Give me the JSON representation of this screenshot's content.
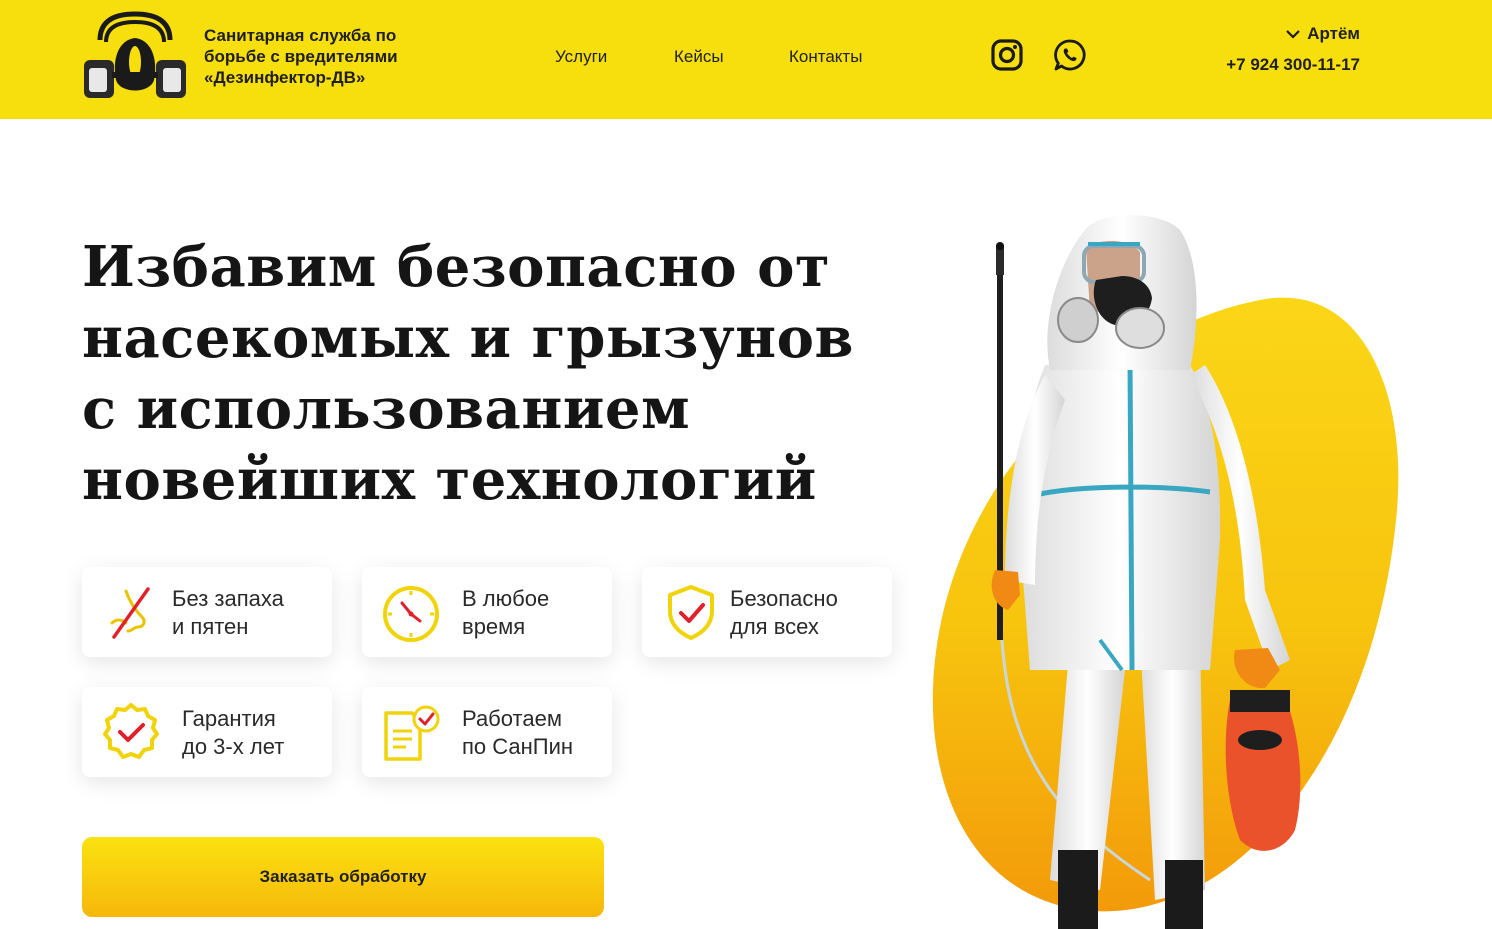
{
  "header": {
    "company_line1": "Санитарная служба по",
    "company_line2": "борьбе с вредителями",
    "company_line3": "«Дезинфектор-ДВ»",
    "nav": [
      "Услуги",
      "Кейсы",
      "Контакты"
    ],
    "social": [
      "instagram-icon",
      "whatsapp-icon"
    ],
    "contact_name": "Артём",
    "contact_phone": "+7 924 300-11-17"
  },
  "hero": {
    "title_lines": [
      "Избавим безопасно от",
      "насекомых и грызунов",
      "с использованием",
      "новейших технологий"
    ],
    "features": [
      {
        "icon": "no-smell-icon",
        "line1": "Без запаха",
        "line2": "и пятен"
      },
      {
        "icon": "clock-icon",
        "line1": "В любое",
        "line2": "время"
      },
      {
        "icon": "shield-check-icon",
        "line1": "Безопасно",
        "line2": "для всех"
      },
      {
        "icon": "guarantee-badge-icon",
        "line1": "Гарантия",
        "line2": "до 3-х лет"
      },
      {
        "icon": "document-check-icon",
        "line1": "Работаем",
        "line2": "по СанПин"
      }
    ],
    "cta_label": "Заказать обработку"
  },
  "colors": {
    "brand_yellow": "#f7df0d",
    "accent_orange": "#f6a10b",
    "check_red": "#e0202a"
  }
}
